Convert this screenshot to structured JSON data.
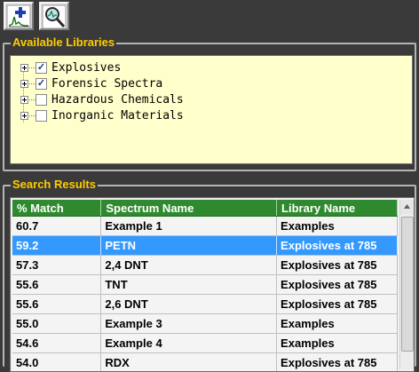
{
  "libraries": {
    "title": "Available Libraries",
    "items": [
      {
        "label": "Explosives",
        "checked": true
      },
      {
        "label": "Forensic Spectra",
        "checked": true
      },
      {
        "label": "Hazardous Chemicals",
        "checked": false
      },
      {
        "label": "Inorganic Materials",
        "checked": false
      }
    ]
  },
  "results": {
    "title": "Search Results",
    "columns": [
      "% Match",
      "Spectrum Name",
      "Library Name"
    ],
    "rows": [
      {
        "match": "60.7",
        "name": "Example 1",
        "library": "Examples",
        "selected": false
      },
      {
        "match": "59.2",
        "name": "PETN",
        "library": "Explosives at 785",
        "selected": true
      },
      {
        "match": "57.3",
        "name": "2,4 DNT",
        "library": "Explosives at 785",
        "selected": false
      },
      {
        "match": "55.6",
        "name": "TNT",
        "library": "Explosives at 785",
        "selected": false
      },
      {
        "match": "55.6",
        "name": "2,6 DNT",
        "library": "Explosives at 785",
        "selected": false
      },
      {
        "match": "55.0",
        "name": "Example 3",
        "library": "Examples",
        "selected": false
      },
      {
        "match": "54.6",
        "name": "Example 4",
        "library": "Examples",
        "selected": false
      },
      {
        "match": "54.0",
        "name": "RDX",
        "library": "Explosives at 785",
        "selected": false
      }
    ]
  },
  "colors": {
    "header_green": "#2f8a2f",
    "selection_blue": "#3399ff",
    "legend_gold": "#ffcc00",
    "library_panel": "#ffffcc"
  },
  "icons": [
    "add-spectrum-icon",
    "search-library-icon"
  ]
}
